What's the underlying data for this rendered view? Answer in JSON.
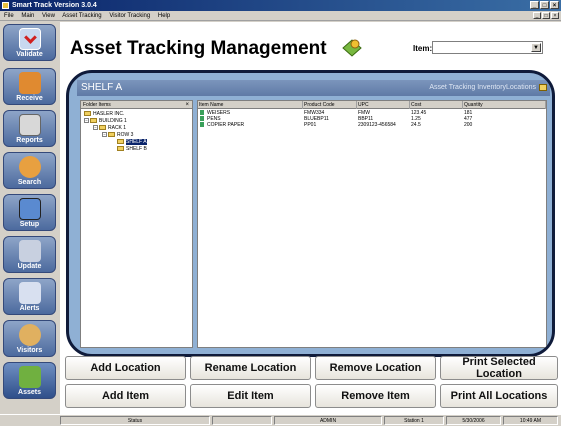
{
  "window": {
    "title": "Smart Track Version 3.0.4"
  },
  "menu": [
    "File",
    "Main",
    "View",
    "Asset Tracking",
    "Visitor Tracking",
    "Help"
  ],
  "sidebar": {
    "items": [
      {
        "label": "Validate",
        "color": "#c8d8f0"
      },
      {
        "label": "Receive",
        "color": "#e08a30"
      },
      {
        "label": "Reports",
        "color": "#d8d8d8"
      },
      {
        "label": "Search",
        "color": "#e8a040"
      },
      {
        "label": "Setup",
        "color": "#5a8ad0"
      },
      {
        "label": "Update",
        "color": "#c8d0e0"
      },
      {
        "label": "Alerts",
        "color": "#d8e0f0"
      },
      {
        "label": "Visitors",
        "color": "#e0b060"
      },
      {
        "label": "Assets",
        "color": "#70b040"
      }
    ]
  },
  "header": {
    "title": "Asset Tracking Management",
    "item_label": "Item:",
    "item_value": ""
  },
  "panel": {
    "title": "SHELF A",
    "crumb": "Asset Tracking InventoryLocations"
  },
  "tree": {
    "header": "Folder Items",
    "close": "×",
    "nodes": [
      {
        "label": "HASLER INC."
      },
      {
        "label": "BUILDING 1"
      },
      {
        "label": "RACK 1"
      },
      {
        "label": "ROW 3"
      },
      {
        "label": "SHELF A"
      },
      {
        "label": "SHELF B"
      }
    ]
  },
  "grid": {
    "columns": [
      "Item Name",
      "Product Code",
      "UPC",
      "Cost",
      "Quantity"
    ],
    "rows": [
      [
        "WEISERS",
        "FMW334",
        "FMW",
        "123.45",
        "181"
      ],
      [
        "PENS",
        "BLUEBP11",
        "BBP11",
        "1.25",
        "477"
      ],
      [
        "COPIER PAPER",
        "PP01",
        "2309123-456584",
        "24.5",
        "200"
      ]
    ]
  },
  "buttons": {
    "add_location": "Add Location",
    "rename_location": "Rename Location",
    "remove_location": "Remove Location",
    "print_selected_location": "Print Selected Location",
    "add_item": "Add Item",
    "edit_item": "Edit Item",
    "remove_item": "Remove Item",
    "print_all_locations": "Print All Locations"
  },
  "status": {
    "status": "Status",
    "user": "ADMIN",
    "station": "Station 1",
    "date": "5/30/2006",
    "time": "10:49 AM"
  },
  "colors": {
    "accent": "#4c6a9e",
    "frame": "#8fb0d4"
  }
}
